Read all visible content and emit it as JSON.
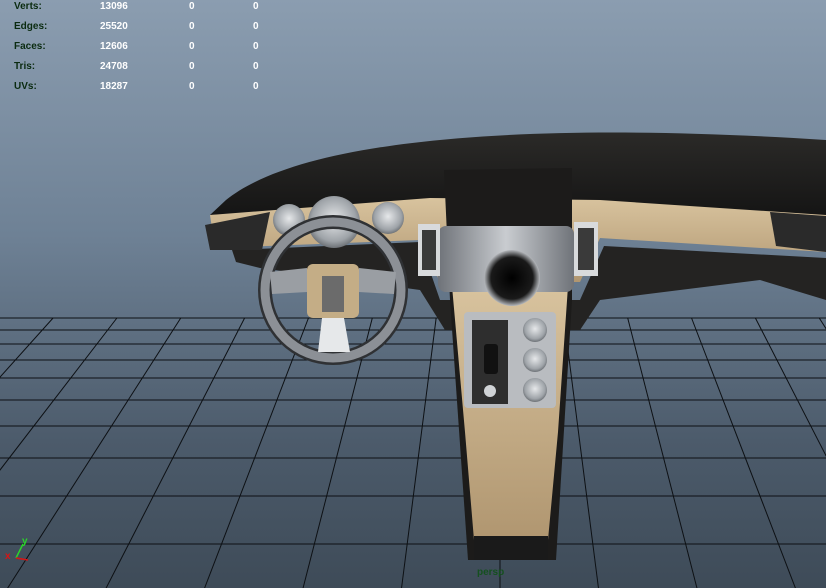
{
  "heads_up_display": {
    "rows": [
      {
        "label": "Verts:",
        "total": "13096",
        "selected": "0",
        "component": "0"
      },
      {
        "label": "Edges:",
        "total": "25520",
        "selected": "0",
        "component": "0"
      },
      {
        "label": "Faces:",
        "total": "12606",
        "selected": "0",
        "component": "0"
      },
      {
        "label": "Tris:",
        "total": "24708",
        "selected": "0",
        "component": "0"
      },
      {
        "label": "UVs:",
        "total": "18287",
        "selected": "0",
        "component": "0"
      }
    ]
  },
  "viewport": {
    "camera_name": "persp",
    "axis": {
      "x_label": "x",
      "y_label": "y"
    }
  },
  "colors": {
    "hud_label": "#0a2b10",
    "hud_value": "#ffffff",
    "camera_label": "#15501f",
    "grid_line": "#0d1014",
    "dashboard_black": "#1c1b1a",
    "dashboard_beige": "#c4ad86",
    "console_silver": "#9a9ea3",
    "axis_x": "#d81414",
    "axis_y": "#2bd42b"
  },
  "icons": [
    "axis-gizmo-icon"
  ]
}
